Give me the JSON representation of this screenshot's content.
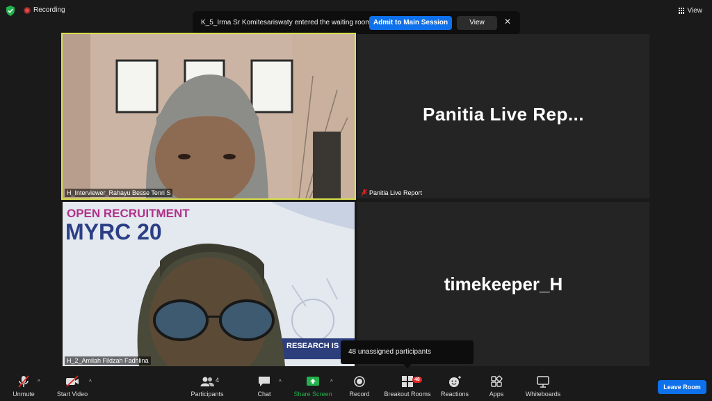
{
  "top_bar": {
    "recording_label": "Recording",
    "view_label": "View"
  },
  "notification": {
    "message": "K_5_Irma Sr Komitesariswaty entered the waiting room",
    "admit_label": "Admit to Main Session",
    "view_label": "View",
    "close_glyph": "✕"
  },
  "tiles": [
    {
      "name": "H_Interviewer_Rahayu Besse Tenri S",
      "has_video": true,
      "active_speaker": true
    },
    {
      "name": "Panitia Live Report",
      "display_name": "Panitia  Live  Rep...",
      "has_video": false,
      "muted": true
    },
    {
      "name": "H_2_Amilah Fildzah Fadhlina",
      "has_video": true,
      "background_text": [
        "OPEN RECRUITMENT",
        "MYRC 20",
        "RESEARCH IS F"
      ]
    },
    {
      "name": "timekeeper_H",
      "display_name": "timekeeper_H",
      "has_video": false
    }
  ],
  "tooltip": {
    "text": "48 unassigned participants"
  },
  "toolbar": {
    "unmute_label": "Unmute",
    "start_video_label": "Start Video",
    "participants_label": "Participants",
    "participants_count": "4",
    "chat_label": "Chat",
    "share_screen_label": "Share Screen",
    "record_label": "Record",
    "breakout_label": "Breakout Rooms",
    "breakout_badge": "48",
    "reactions_label": "Reactions",
    "apps_label": "Apps",
    "whiteboards_label": "Whiteboards",
    "leave_label": "Leave Room",
    "caret_glyph": "^"
  },
  "colors": {
    "accent_blue": "#0e71eb",
    "active_speaker_border": "#d8e04a",
    "recording_red": "#e24a4a",
    "share_green": "#23b14d",
    "badge_red": "#e02828"
  }
}
